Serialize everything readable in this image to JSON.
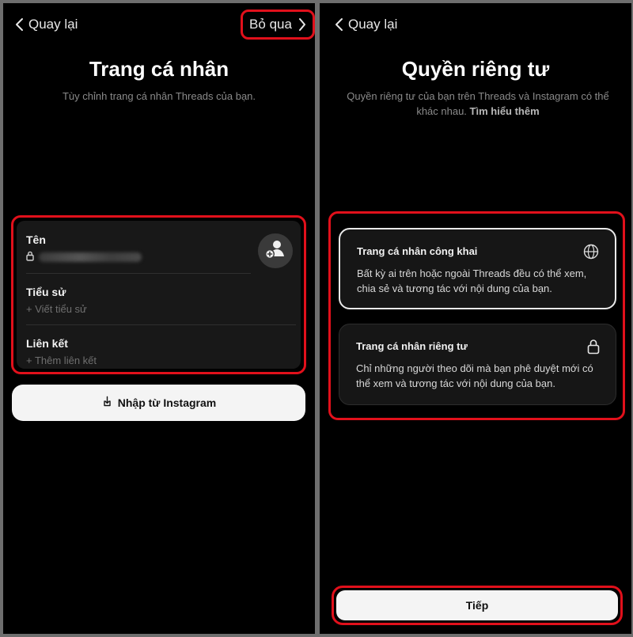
{
  "left": {
    "back_label": "Quay lại",
    "skip_label": "Bỏ qua",
    "title": "Trang cá nhân",
    "subtitle": "Tùy chỉnh trang cá nhân Threads của bạn.",
    "fields": {
      "name": {
        "label": "Tên"
      },
      "bio": {
        "label": "Tiểu sử",
        "placeholder": "+ Viết tiểu sử"
      },
      "link": {
        "label": "Liên kết",
        "placeholder": "+ Thêm liên kết"
      }
    },
    "import_label": "Nhập từ Instagram",
    "icons": [
      "chevron-left-icon",
      "chevron-right-icon",
      "lock-icon",
      "add-avatar-icon",
      "import-icon"
    ]
  },
  "right": {
    "back_label": "Quay lại",
    "title": "Quyền riêng tư",
    "subtitle": "Quyền riêng tư của bạn trên Threads và Instagram có thể khác nhau.",
    "learn_more": "Tìm hiểu thêm",
    "options": [
      {
        "title": "Trang cá nhân công khai",
        "description": "Bất kỳ ai trên hoặc ngoài Threads đều có thể xem, chia sẻ và tương tác với nội dung của bạn.",
        "icon": "globe-icon",
        "selected": true
      },
      {
        "title": "Trang cá nhân riêng tư",
        "description": "Chỉ những người theo dõi mà bạn phê duyệt mới có thể xem và tương tác với nội dung của bạn.",
        "icon": "lock-icon",
        "selected": false
      }
    ],
    "next_label": "Tiếp"
  },
  "colors": {
    "highlight": "#e1101b",
    "background": "#000000",
    "card": "#181818",
    "button": "#f4f4f4"
  }
}
